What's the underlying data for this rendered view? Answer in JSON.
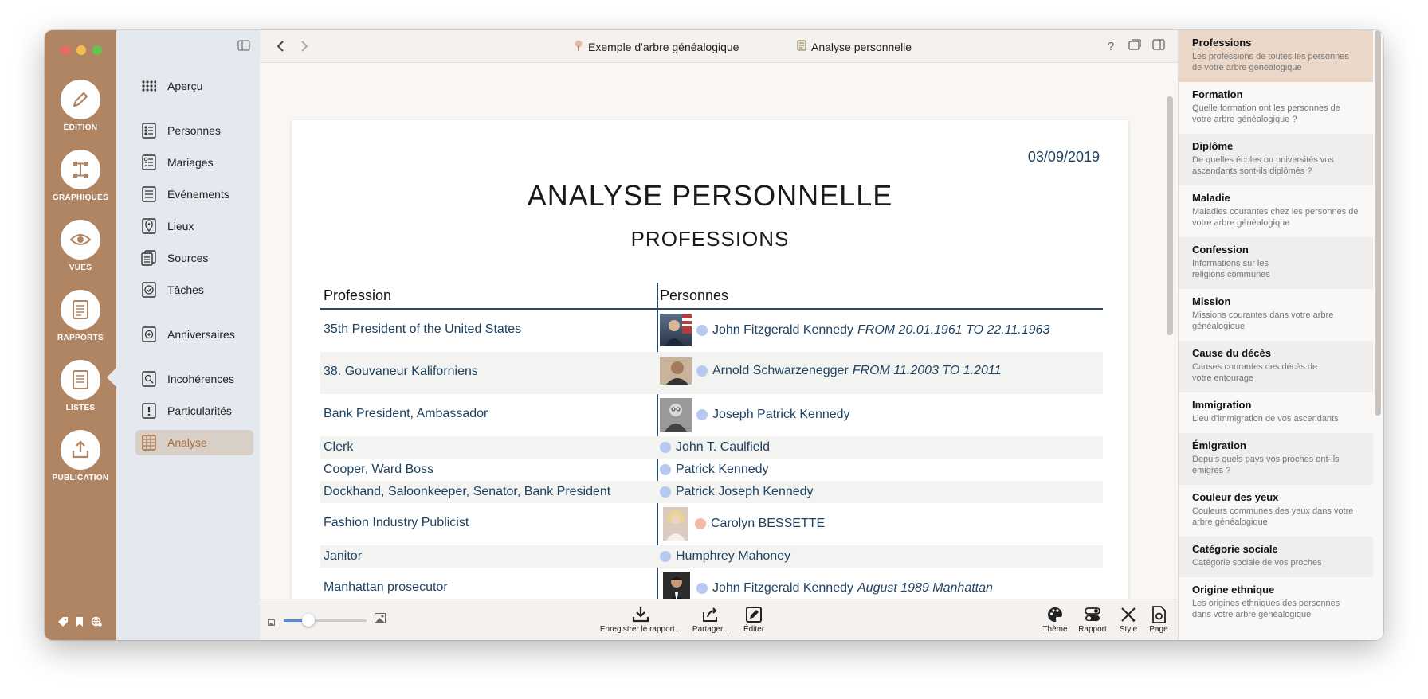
{
  "rail": {
    "items": [
      {
        "label": "ÉDITION",
        "icon": "pencil-icon"
      },
      {
        "label": "GRAPHIQUES",
        "icon": "tree-chart-icon"
      },
      {
        "label": "VUES",
        "icon": "eye-icon"
      },
      {
        "label": "RAPPORTS",
        "icon": "report-icon"
      },
      {
        "label": "LISTES",
        "icon": "list-icon"
      },
      {
        "label": "PUBLICATION",
        "icon": "share-upload-icon"
      }
    ]
  },
  "sidebar": {
    "items": [
      {
        "label": "Aperçu",
        "icon": "grid-icon"
      },
      {
        "label": "Personnes",
        "icon": "persons-list-icon"
      },
      {
        "label": "Mariages",
        "icon": "marriages-list-icon"
      },
      {
        "label": "Événements",
        "icon": "events-list-icon"
      },
      {
        "label": "Lieux",
        "icon": "place-pin-icon"
      },
      {
        "label": "Sources",
        "icon": "sources-icon"
      },
      {
        "label": "Tâches",
        "icon": "tasks-check-icon"
      },
      {
        "label": "Anniversaires",
        "icon": "anniversary-icon"
      },
      {
        "label": "Incohérences",
        "icon": "inconsistency-search-icon"
      },
      {
        "label": "Particularités",
        "icon": "exclamation-icon"
      },
      {
        "label": "Analyse",
        "icon": "analysis-icon"
      }
    ]
  },
  "topbar": {
    "breadcrumb_tree": "Exemple d'arbre généalogique",
    "breadcrumb_report": "Analyse personnelle",
    "help": "?"
  },
  "report": {
    "date": "03/09/2019",
    "title": "ANALYSE PERSONNELLE",
    "subtitle": "PROFESSIONS",
    "col_profession": "Profession",
    "col_persons": "Personnes",
    "rows": [
      {
        "profession": "35th President of the United States",
        "name": "John Fitzgerald Kennedy",
        "detail": "FROM 20.01.1961 TO 22.11.1963",
        "photo": true,
        "gender": "m"
      },
      {
        "profession": "38. Gouvaneur Kaliforniens",
        "name": "Arnold Schwarzenegger",
        "detail": "FROM 11.2003 TO 1.2011",
        "photo": true,
        "gender": "m"
      },
      {
        "profession": "Bank President, Ambassador",
        "name": "Joseph Patrick Kennedy",
        "detail": "",
        "photo": true,
        "gender": "m"
      },
      {
        "profession": "Clerk",
        "name": "John T. Caulfield",
        "detail": "",
        "photo": false,
        "gender": "m"
      },
      {
        "profession": "Cooper, Ward Boss",
        "name": "Patrick Kennedy",
        "detail": "",
        "photo": false,
        "gender": "m"
      },
      {
        "profession": "Dockhand, Saloonkeeper, Senator, Bank President",
        "name": "Patrick Joseph Kennedy",
        "detail": "",
        "photo": false,
        "gender": "m"
      },
      {
        "profession": "Fashion Industry Publicist",
        "name": "Carolyn BESSETTE",
        "detail": "",
        "photo": true,
        "gender": "f"
      },
      {
        "profession": "Janitor",
        "name": "Humphrey Mahoney",
        "detail": "",
        "photo": false,
        "gender": "m"
      },
      {
        "profession": "Manhattan prosecutor",
        "name": "John Fitzgerald Kennedy",
        "detail": "August 1989 Manhattan",
        "photo": true,
        "gender": "m"
      }
    ]
  },
  "bottombar": {
    "zoom": 0.3,
    "tools_center": [
      {
        "label": "Enregistrer le rapport...",
        "icon": "download-icon"
      },
      {
        "label": "Partager...",
        "icon": "share-icon"
      },
      {
        "label": "Éditer",
        "icon": "edit-icon"
      }
    ],
    "tools_right": [
      {
        "label": "Thème",
        "icon": "palette-icon"
      },
      {
        "label": "Rapport",
        "icon": "toggles-icon"
      },
      {
        "label": "Style",
        "icon": "brush-icon"
      },
      {
        "label": "Page",
        "icon": "page-settings-icon"
      }
    ]
  },
  "right_panel": {
    "items": [
      {
        "title": "Professions",
        "desc": "Les professions de toutes les personnes de votre arbre généalogique"
      },
      {
        "title": "Formation",
        "desc": "Quelle formation ont les personnes de votre arbre généalogique ?"
      },
      {
        "title": "Diplôme",
        "desc": "De quelles écoles ou universités vos ascendants sont-ils diplômés ?"
      },
      {
        "title": "Maladie",
        "desc": "Maladies courantes chez les personnes de votre arbre généalogique"
      },
      {
        "title": "Confession",
        "desc": "Informations sur les religions communes"
      },
      {
        "title": "Mission",
        "desc": "Missions courantes dans votre arbre généalogique"
      },
      {
        "title": "Cause du décès",
        "desc": "Causes courantes des décès de votre entourage"
      },
      {
        "title": "Immigration",
        "desc": "Lieu d'immigration de vos ascendants"
      },
      {
        "title": "Émigration",
        "desc": "Depuis quels pays vos proches ont-ils émigrés ?"
      },
      {
        "title": "Couleur des yeux",
        "desc": "Couleurs communes des yeux dans votre arbre généalogique"
      },
      {
        "title": "Catégorie sociale",
        "desc": "Catégorie sociale de vos proches"
      },
      {
        "title": "Origine ethnique",
        "desc": "Les origines ethniques des personnes dans votre arbre généalogique"
      }
    ]
  },
  "colors": {
    "rail": "#b08563",
    "sidebar": "#e3e9ee",
    "accent_text": "#a56d3e",
    "report_text": "#1e4262",
    "male_dot": "#b7c9f0",
    "female_dot": "#f2b9a3",
    "active_panel": "#ebd7c7"
  }
}
